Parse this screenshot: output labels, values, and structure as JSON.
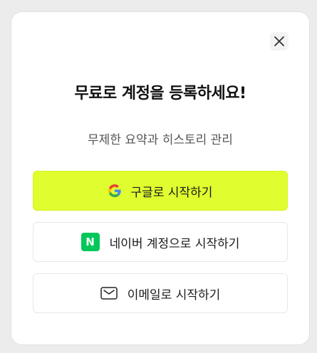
{
  "modal": {
    "title": "무료로 계정을 등록하세요!",
    "subtitle": "무제한 요약과 히스토리 관리",
    "close_icon": "close-icon"
  },
  "buttons": {
    "google": {
      "label": "구글로 시작하기",
      "icon": "google-icon"
    },
    "naver": {
      "label": "네이버 계정으로 시작하기",
      "icon": "naver-icon",
      "icon_letter": "N"
    },
    "email": {
      "label": "이메일로 시작하기",
      "icon": "mail-icon"
    }
  },
  "colors": {
    "google_button_bg": "#dffd2f",
    "naver_green": "#03c75a"
  }
}
